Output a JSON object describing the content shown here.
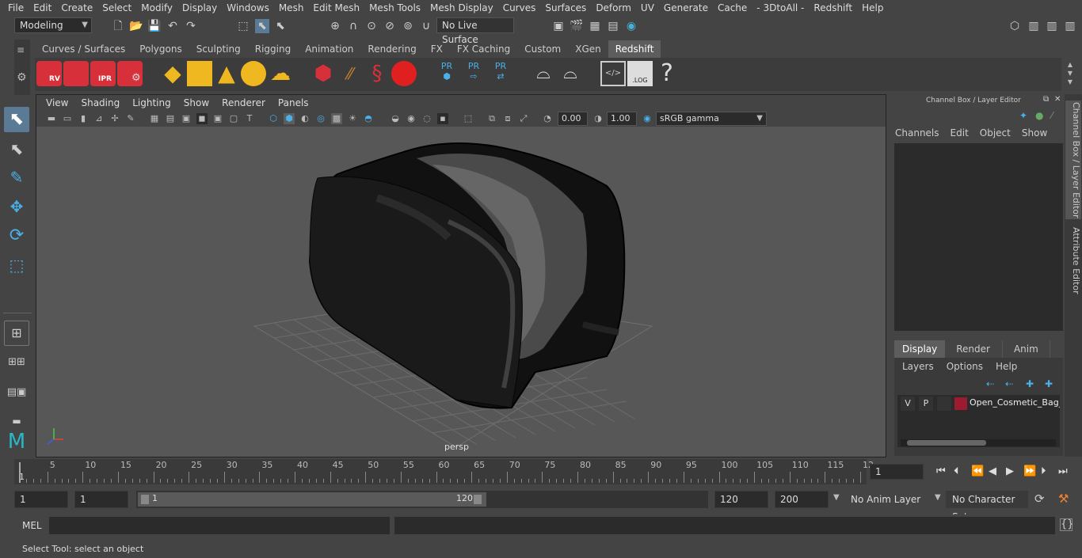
{
  "menubar": [
    "File",
    "Edit",
    "Create",
    "Select",
    "Modify",
    "Display",
    "Windows",
    "Mesh",
    "Edit Mesh",
    "Mesh Tools",
    "Mesh Display",
    "Curves",
    "Surfaces",
    "Deform",
    "UV",
    "Generate",
    "Cache",
    "- 3DtoAll -",
    "Redshift",
    "Help"
  ],
  "status_line": {
    "mode": "Modeling",
    "live_surface": "No Live Surface"
  },
  "shelf": {
    "tabs": [
      "Curves / Surfaces",
      "Polygons",
      "Sculpting",
      "Rigging",
      "Animation",
      "Rendering",
      "FX",
      "FX Caching",
      "Custom",
      "XGen",
      "Redshift"
    ],
    "active_tab": "Redshift",
    "icon_labels": {
      "rv": "RV",
      "ipr": "IPR",
      "pr1": "PR",
      "pr2": "PR",
      "pr3": "PR",
      "log": ".LOG",
      "help": "?"
    }
  },
  "viewport": {
    "menu": [
      "View",
      "Shading",
      "Lighting",
      "Show",
      "Renderer",
      "Panels"
    ],
    "exposure": "0.00",
    "gamma": "1.00",
    "color_space": "sRGB gamma",
    "camera_label": "persp"
  },
  "channel_box": {
    "title": "Channel Box / Layer Editor",
    "menu": [
      "Channels",
      "Edit",
      "Object",
      "Show"
    ]
  },
  "layer_editor": {
    "tabs": [
      "Display",
      "Render",
      "Anim"
    ],
    "active_tab": "Display",
    "menu": [
      "Layers",
      "Options",
      "Help"
    ],
    "layer": {
      "v": "V",
      "p": "P",
      "name": "Open_Cosmetic_Bag_L",
      "color": "#9b1b30"
    }
  },
  "side_tabs": [
    "Channel Box / Layer Editor",
    "Attribute Editor"
  ],
  "timeline": {
    "ticks": [
      "5",
      "10",
      "15",
      "20",
      "25",
      "30",
      "35",
      "40",
      "45",
      "50",
      "55",
      "60",
      "65",
      "70",
      "75",
      "80",
      "85",
      "90",
      "95",
      "100",
      "105",
      "110",
      "115",
      "12"
    ],
    "start_marker": "1",
    "current_frame": "1"
  },
  "range": {
    "start_field": "1",
    "playback_start": "1",
    "slider_start": "1",
    "slider_end": "120",
    "end_field": "120",
    "anim_end": "200",
    "anim_layer": "No Anim Layer",
    "character_set": "No Character Set"
  },
  "command_line": {
    "label": "MEL"
  },
  "help_line": "Select Tool: select an object"
}
